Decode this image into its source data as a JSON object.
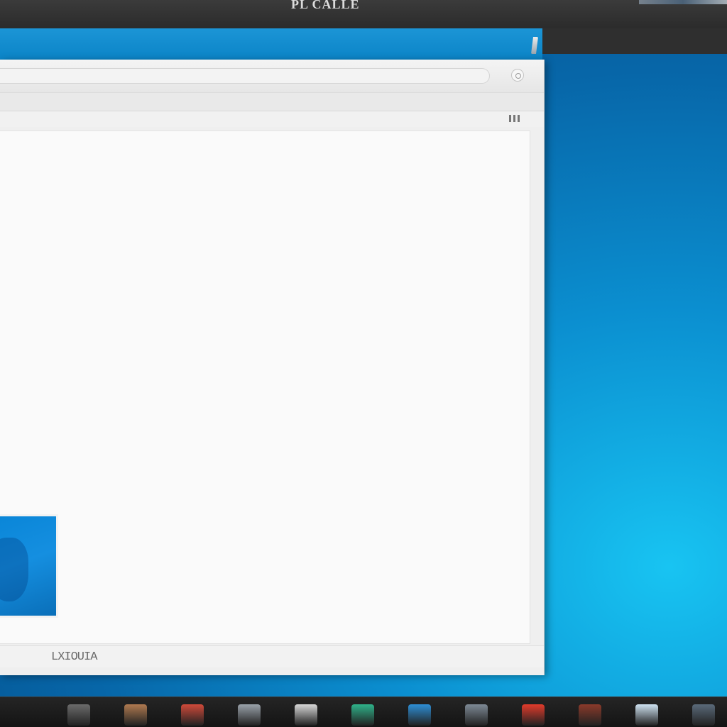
{
  "window": {
    "title": "PL CALLE",
    "address_value": "",
    "address_placeholder": ""
  },
  "status_bar": {
    "text": "LXIOUIA"
  },
  "taskbar": {
    "items": [
      {
        "name": "folder-app",
        "color": "#6b6b6b"
      },
      {
        "name": "people-app",
        "color": "#b07a50"
      },
      {
        "name": "media-app",
        "color": "#d04a3a"
      },
      {
        "name": "avatar-app",
        "color": "#9aa2aa"
      },
      {
        "name": "phone-app",
        "color": "#d7d7d7"
      },
      {
        "name": "game-app",
        "color": "#2fb38a"
      },
      {
        "name": "tv-app",
        "color": "#2e8fd6"
      },
      {
        "name": "glass-app",
        "color": "#7e8a96"
      },
      {
        "name": "paint-app",
        "color": "#e23b2b"
      },
      {
        "name": "photo-app",
        "color": "#8b3a2a"
      },
      {
        "name": "monitor-app",
        "color": "#cfe3f2"
      },
      {
        "name": "window-app",
        "color": "#5a6a7a"
      }
    ]
  },
  "colors": {
    "desktop_accent": "#0b8fd0",
    "titlebar": "#1590d4",
    "thumbnail": "#158fe0"
  }
}
